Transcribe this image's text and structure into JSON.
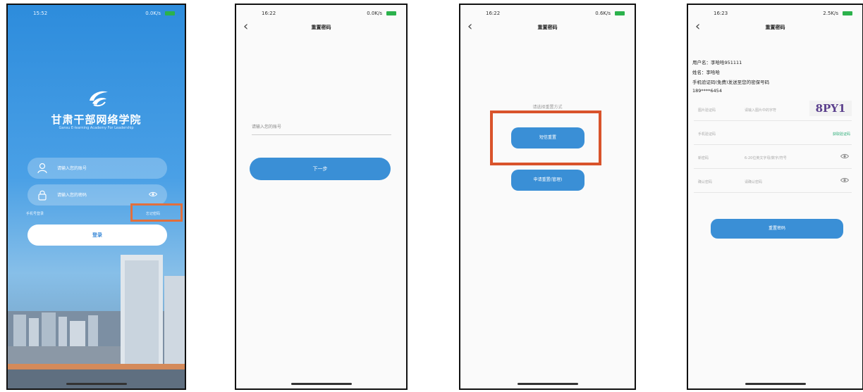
{
  "screens": {
    "login": {
      "time": "15:52",
      "status_net": "0.0K/s",
      "app_title": "甘肃干部网络学院",
      "app_subtitle": "Gansu E-learning Academy For Leadership",
      "account_placeholder": "请输入您的账号",
      "password_placeholder": "请输入您的密码",
      "phone_login": "手机号登录",
      "forgot_password": "忘记密码",
      "login_button": "登录"
    },
    "reset_step1": {
      "time": "16:22",
      "status_net": "0.0K/s",
      "title": "重置密码",
      "account_placeholder": "请输入您的账号",
      "next_button": "下一步"
    },
    "reset_choose": {
      "time": "16:22",
      "status_net": "0.6K/s",
      "title": "重置密码",
      "choose_label": "请选择重置方式",
      "option_sms": "短信重置",
      "option_apply": "申请重置(管理)"
    },
    "reset_sms": {
      "time": "16:23",
      "status_net": "2.5K/s",
      "title": "重置密码",
      "username_line": "用户名：李哈哈951111",
      "name_line": "姓名：李哈哈",
      "sms_hint": "手机验证码(免费)发送至您的密保号码",
      "phone": "189****6454",
      "captcha_label": "图片验证码",
      "captcha_placeholder": "请输入图片中的字符",
      "captcha_text": "8PY1",
      "sms_label": "手机验证码",
      "get_code": "获取验证码",
      "new_pwd_label": "新密码",
      "new_pwd_placeholder": "6-20位英文字母/数字/符号",
      "confirm_label": "确认密码",
      "confirm_placeholder": "请确认密码",
      "reset_button": "重置密码"
    }
  }
}
